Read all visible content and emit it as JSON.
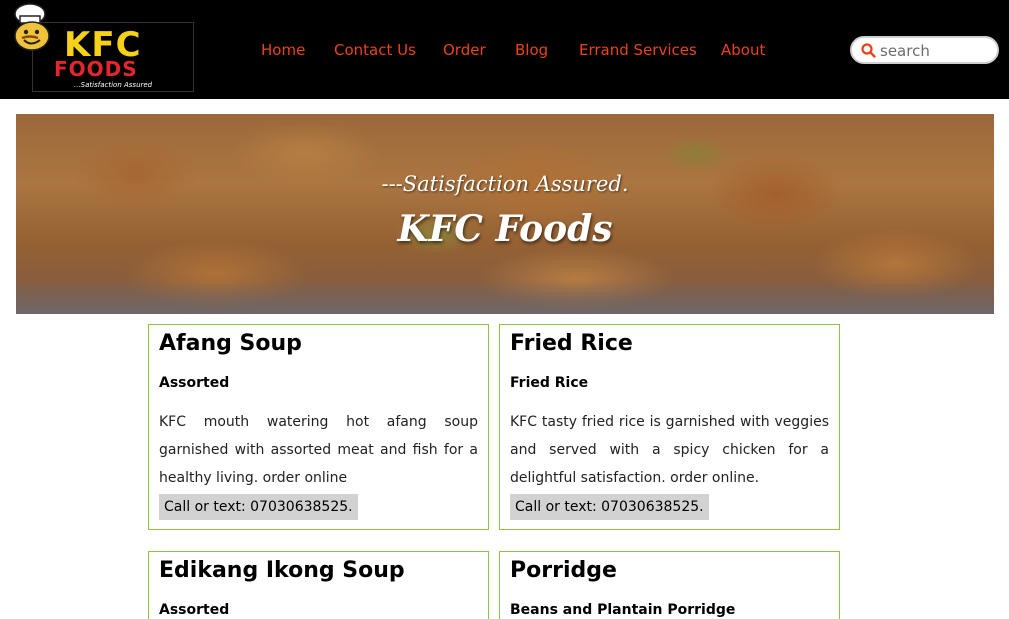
{
  "header": {
    "logo": {
      "brand": "KFC",
      "sub": "FOODS",
      "tagline": "...Satisfaction Assured"
    },
    "nav": [
      {
        "label": "Home"
      },
      {
        "label": "Contact Us"
      },
      {
        "label": "Order"
      },
      {
        "label": "Blog"
      },
      {
        "label": "Errand Services"
      },
      {
        "label": "About"
      }
    ],
    "search": {
      "placeholder": "search",
      "icon": "search-icon"
    }
  },
  "hero": {
    "tagline": "---Satisfaction Assured.",
    "title": "KFC Foods"
  },
  "cards": [
    {
      "title": "Afang Soup",
      "subtitle": "Assorted",
      "description": "KFC mouth watering hot afang soup garnished with assorted meat and fish for a healthy living. order online",
      "call": "Call or text: 07030638525."
    },
    {
      "title": "Fried Rice",
      "subtitle": "Fried Rice",
      "description": "KFC tasty fried rice is garnished with veggies and served with a spicy chicken for a delightful satisfaction. order online.",
      "call": "Call or text: 07030638525."
    },
    {
      "title": "Edikang Ikong Soup",
      "subtitle": "Assorted"
    },
    {
      "title": "Porridge",
      "subtitle": "Beans and Plantain Porridge"
    }
  ],
  "colors": {
    "header_bg": "#000000",
    "nav_link": "#e8431c",
    "card_border": "#8dc63f",
    "call_bg": "#d2d2d2",
    "logo_yellow": "#f7d117",
    "logo_red": "#e3262e"
  }
}
